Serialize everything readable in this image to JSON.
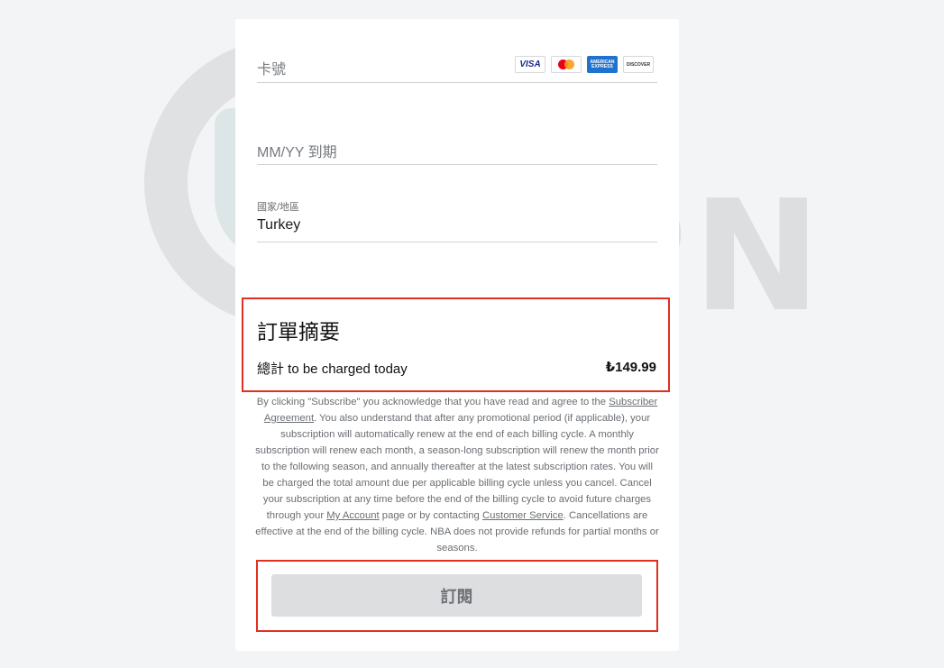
{
  "payment_form": {
    "card_number_placeholder": "卡號",
    "card_brands": [
      "VISA",
      "Mastercard",
      "American Express",
      "DISCOVER"
    ],
    "expiry_placeholder": "MM/YY 到期",
    "country_label": "國家/地區",
    "country_value": "Turkey"
  },
  "summary": {
    "title": "訂單摘要",
    "total_label": "總計 to be charged today",
    "total_amount": "₺149.99"
  },
  "legal": {
    "p1": "By clicking \"Subscribe\" you acknowledge that you have read and agree to the ",
    "subscriber_agreement": "Subscriber Agreement",
    "p2": ". You also understand that after any promotional period (if applicable), your subscription will automatically renew at the end of each billing cycle. A monthly subscription will renew each month, a season-long subscription will renew the month prior to the following season, and annually thereafter at the latest subscription rates. You will be charged the total amount due per applicable billing cycle unless you cancel. Cancel your subscription at any time before the end of the billing cycle to avoid future charges through your ",
    "my_account": "My Account",
    "p3": " page or by contacting ",
    "customer_service": "Customer Service",
    "p4": ". Cancellations are effective at the end of the billing cycle. NBA does not provide refunds for partial months or seasons."
  },
  "subscribe_button": {
    "label": "訂閱"
  },
  "watermark": {
    "text_top": "GO",
    "text_bottom": "VPN"
  }
}
